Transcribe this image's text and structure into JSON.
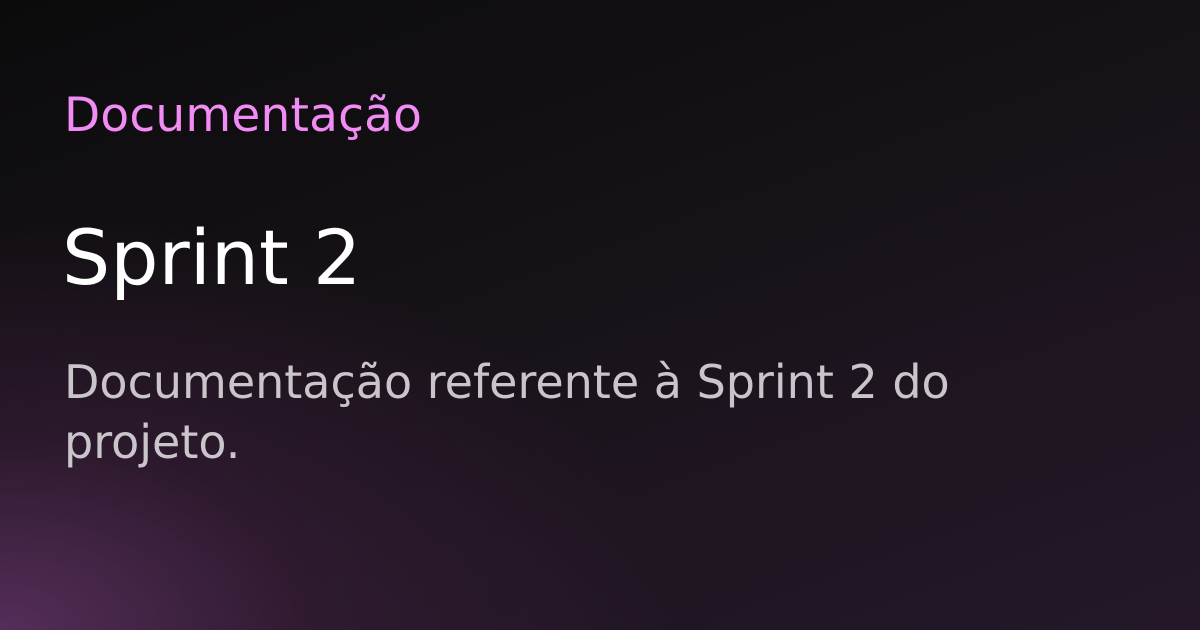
{
  "card": {
    "eyebrow": "Documentação",
    "title": "Sprint 2",
    "description": "Documentação referente à Sprint 2 do projeto."
  },
  "colors": {
    "eyebrow": "#f08cf4",
    "title": "#ffffff",
    "description": "#c9c5cb",
    "background_dark": "#0b0b0c",
    "background_accent": "#5f3264"
  }
}
